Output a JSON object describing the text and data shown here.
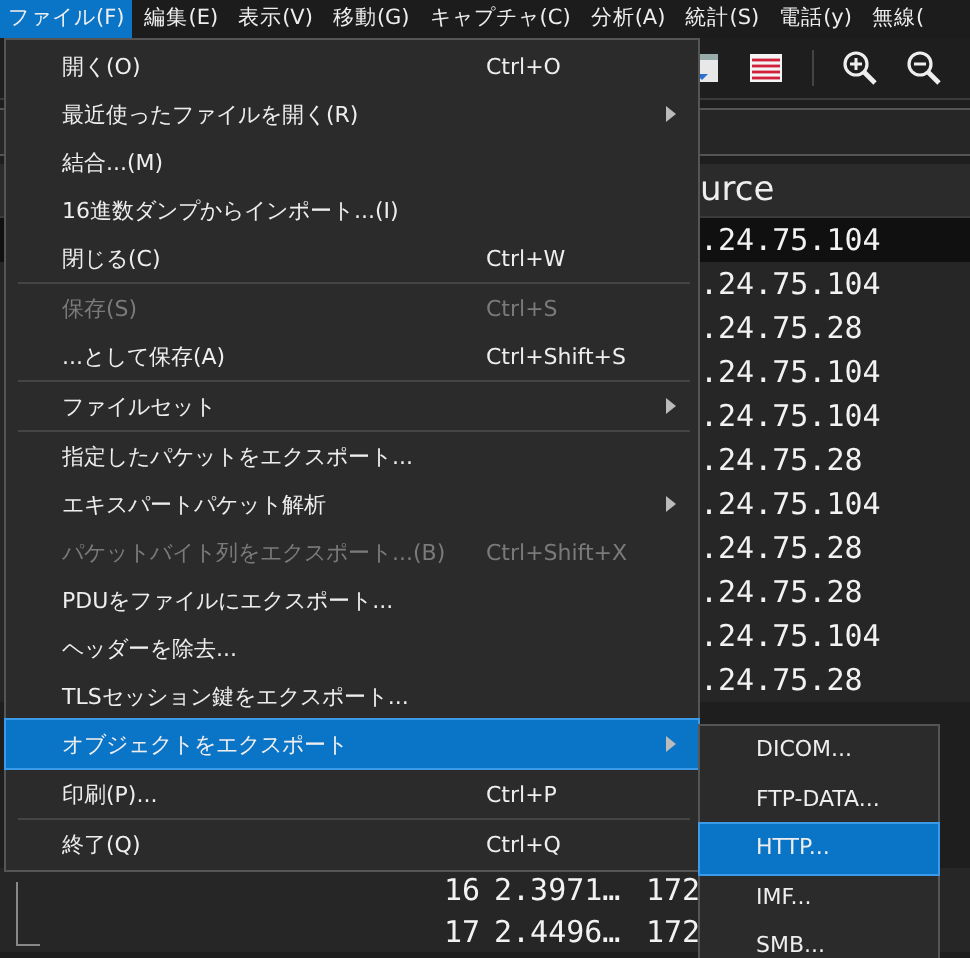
{
  "menubar": [
    {
      "label": "ファイル(F)",
      "selected": true
    },
    {
      "label": "編集(E)",
      "selected": false
    },
    {
      "label": "表示(V)",
      "selected": false
    },
    {
      "label": "移動(G)",
      "selected": false
    },
    {
      "label": "キャプチャ(C)",
      "selected": false
    },
    {
      "label": "分析(A)",
      "selected": false
    },
    {
      "label": "統計(S)",
      "selected": false
    },
    {
      "label": "電話(y)",
      "selected": false
    },
    {
      "label": "無線(",
      "selected": false
    }
  ],
  "packet_list": {
    "column_header": "urce",
    "rows": [
      {
        "source": ".24.75.104",
        "selected": true
      },
      {
        "source": ".24.75.104",
        "selected": false
      },
      {
        "source": ".24.75.28",
        "selected": false
      },
      {
        "source": ".24.75.104",
        "selected": false
      },
      {
        "source": ".24.75.104",
        "selected": false
      },
      {
        "source": ".24.75.28",
        "selected": false
      },
      {
        "source": ".24.75.104",
        "selected": false
      },
      {
        "source": ".24.75.28",
        "selected": false
      },
      {
        "source": ".24.75.28",
        "selected": false
      },
      {
        "source": ".24.75.104",
        "selected": false
      },
      {
        "source": ".24.75.28",
        "selected": false
      }
    ],
    "bottom_rows": [
      {
        "no": "16",
        "time": "2.3971…",
        "source": "172"
      },
      {
        "no": "17",
        "time": "2.4496…",
        "source": "172"
      }
    ]
  },
  "file_menu": [
    {
      "kind": "item",
      "label": "開く(O)",
      "shortcut": "Ctrl+O",
      "submenu": false,
      "disabled": false,
      "selected": false
    },
    {
      "kind": "item",
      "label": "最近使ったファイルを開く(R)",
      "submenu": true,
      "disabled": false,
      "selected": false
    },
    {
      "kind": "item",
      "label": "結合...(M)",
      "submenu": false,
      "disabled": false,
      "selected": false
    },
    {
      "kind": "item",
      "label": "16進数ダンプからインポート...(I)",
      "submenu": false,
      "disabled": false,
      "selected": false
    },
    {
      "kind": "item",
      "label": "閉じる(C)",
      "shortcut": "Ctrl+W",
      "submenu": false,
      "disabled": false,
      "selected": false
    },
    {
      "kind": "separator"
    },
    {
      "kind": "item",
      "label": "保存(S)",
      "shortcut": "Ctrl+S",
      "submenu": false,
      "disabled": true,
      "selected": false
    },
    {
      "kind": "item",
      "label": "...として保存(A)",
      "shortcut": "Ctrl+Shift+S",
      "submenu": false,
      "disabled": false,
      "selected": false
    },
    {
      "kind": "separator"
    },
    {
      "kind": "item",
      "label": "ファイルセット",
      "submenu": true,
      "disabled": false,
      "selected": false
    },
    {
      "kind": "separator"
    },
    {
      "kind": "item",
      "label": "指定したパケットをエクスポート...",
      "submenu": false,
      "disabled": false,
      "selected": false
    },
    {
      "kind": "item",
      "label": "エキスパートパケット解析",
      "submenu": true,
      "disabled": false,
      "selected": false
    },
    {
      "kind": "item",
      "label": "パケットバイト列をエクスポート...(B)",
      "shortcut": "Ctrl+Shift+X",
      "submenu": false,
      "disabled": true,
      "selected": false
    },
    {
      "kind": "item",
      "label": "PDUをファイルにエクスポート...",
      "submenu": false,
      "disabled": false,
      "selected": false
    },
    {
      "kind": "item",
      "label": "ヘッダーを除去...",
      "submenu": false,
      "disabled": false,
      "selected": false
    },
    {
      "kind": "item",
      "label": "TLSセッション鍵をエクスポート...",
      "submenu": false,
      "disabled": false,
      "selected": false
    },
    {
      "kind": "item",
      "label": "オブジェクトをエクスポート",
      "submenu": true,
      "disabled": false,
      "selected": true
    },
    {
      "kind": "separator"
    },
    {
      "kind": "item",
      "label": "印刷(P)...",
      "shortcut": "Ctrl+P",
      "submenu": false,
      "disabled": false,
      "selected": false
    },
    {
      "kind": "separator"
    },
    {
      "kind": "item",
      "label": "終了(Q)",
      "shortcut": "Ctrl+Q",
      "submenu": false,
      "disabled": false,
      "selected": false
    }
  ],
  "export_submenu": [
    {
      "label": "DICOM...",
      "selected": false
    },
    {
      "label": "FTP-DATA...",
      "selected": false
    },
    {
      "label": "HTTP...",
      "selected": true
    },
    {
      "label": "IMF...",
      "selected": false
    },
    {
      "label": "SMB...",
      "selected": false
    }
  ]
}
